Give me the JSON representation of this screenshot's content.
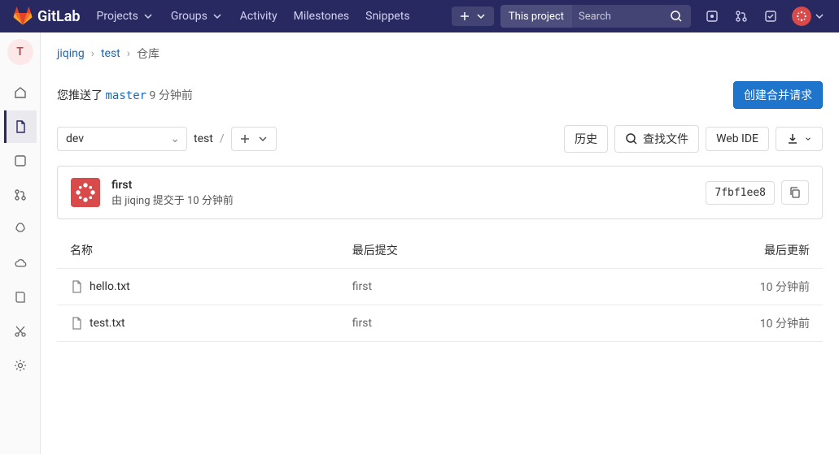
{
  "header": {
    "brand": "GitLab",
    "nav": {
      "projects": "Projects",
      "groups": "Groups",
      "activity": "Activity",
      "milestones": "Milestones",
      "snippets": "Snippets"
    },
    "search_scope": "This project",
    "search_placeholder": "Search"
  },
  "sidebar": {
    "project_letter": "T"
  },
  "breadcrumb": {
    "group": "jiqing",
    "project": "test",
    "current": "仓库"
  },
  "push": {
    "prefix": "您推送了 ",
    "branch": "master",
    "time": " 9 分钟前",
    "mr_button": "创建合并请求"
  },
  "toolbar": {
    "branch": "dev",
    "path": "test",
    "buttons": {
      "history": "历史",
      "find": "查找文件",
      "webide": "Web IDE"
    }
  },
  "commit": {
    "title": "first",
    "by_prefix": "由 ",
    "author": "jiqing",
    "submitted": " 提交于 ",
    "time": "10 分钟前",
    "sha": "7fbf1ee8"
  },
  "table": {
    "headers": {
      "name": "名称",
      "commit": "最后提交",
      "updated": "最后更新"
    },
    "rows": [
      {
        "name": "hello.txt",
        "commit": "first",
        "time": "10 分钟前"
      },
      {
        "name": "test.txt",
        "commit": "first",
        "time": "10 分钟前"
      }
    ]
  }
}
